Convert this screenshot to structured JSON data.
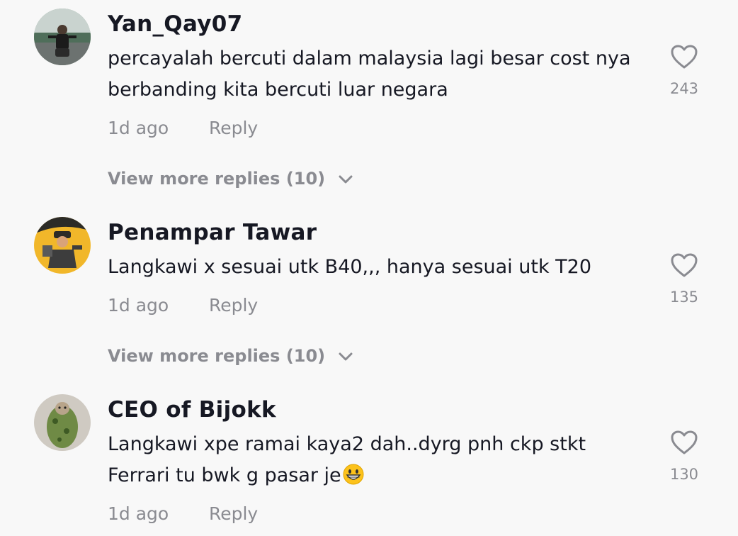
{
  "comments": [
    {
      "username": "Yan_Qay07",
      "text": "percayalah bercuti dalam malaysia lagi besar cost nya berbanding kita bercuti luar negara",
      "time": "1d ago",
      "reply_label": "Reply",
      "likes": "243",
      "more_replies": "View more replies (10)",
      "avatar_icon": "avatar-photo-person-outdoors"
    },
    {
      "username": "Penampar Tawar",
      "text": "Langkawi x sesuai utk B40,,, hanya sesuai utk T20",
      "time": "1d ago",
      "reply_label": "Reply",
      "likes": "135",
      "more_replies": "View more replies (10)",
      "avatar_icon": "avatar-illustration-yellow"
    },
    {
      "username": "CEO of Bijokk",
      "text": "Langkawi xpe ramai kaya2 dah..dyrg pnh ckp stkt Ferrari tu bwk g pasar je",
      "emoji": "grinning-face-emoji",
      "time": "1d ago",
      "reply_label": "Reply",
      "likes": "130",
      "avatar_icon": "avatar-photo-cat"
    }
  ],
  "icons": {
    "like": "heart-outline-icon",
    "expand": "chevron-down-icon"
  },
  "colors": {
    "background": "#f8f8f8",
    "primary_text": "#161823",
    "secondary_text": "#8a8b91"
  }
}
